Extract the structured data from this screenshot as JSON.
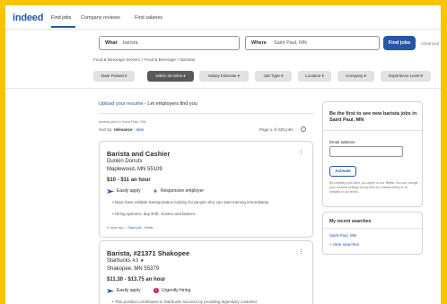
{
  "brand": {
    "logo": "indeed",
    "accent": "#2557a7"
  },
  "nav": {
    "find_jobs": "Find jobs",
    "company_reviews": "Company reviews",
    "find_salaries": "Find salaries"
  },
  "search": {
    "what_label": "What",
    "what_value": "barista",
    "where_label": "Where",
    "where_value": "Saint Paul, MN",
    "find_button": "Find jobs",
    "advanced": "Advanced"
  },
  "breadcrumb": "Food & Beverage Servers > Food & Beverage > Baristas",
  "filters": [
    {
      "label": "Date Posted",
      "active": false
    },
    {
      "label": "within 25 miles",
      "active": true
    },
    {
      "label": "Salary Estimate",
      "active": false
    },
    {
      "label": "Job Type",
      "active": false
    },
    {
      "label": "Location",
      "active": false
    },
    {
      "label": "Company",
      "active": false
    },
    {
      "label": "Experience Level",
      "active": false
    }
  ],
  "results": {
    "upload_link": "Upload your resume",
    "upload_rest": " - Let employers find you",
    "meta": "barista jobs in Saint Paul, MN",
    "sort_prefix": "Sort by: ",
    "sort_active": "relevance",
    "sort_sep": " - ",
    "sort_other": "date",
    "page_of": "Page 1 of 230 jobs"
  },
  "jobs": [
    {
      "title": "Barista and Cashier",
      "company": "Dunkin Donuts",
      "location": "Maplewood, MN 55109",
      "salary": "$10 - $11 an hour",
      "badge1": "Easily apply",
      "badge2": "Responsive employer",
      "bullet1": "Must have reliable transportation looking for people who can start training immediately.",
      "bullet2": "Hiring openers, day shift, closers and Bakers.",
      "posted": "9 days ago",
      "save": "Save job",
      "more": "More..."
    },
    {
      "title": "Barista, #21371 Shakopee",
      "company": "Starbucks",
      "rating": "4.0",
      "location": "Shakopee, MN 55379",
      "salary": "$11.30 - $13.75 an hour",
      "badge1": "Easily apply",
      "badge2": "Urgently hiring",
      "bullet1": "This position contributes to Starbucks success by providing legendary customer"
    }
  ],
  "alert": {
    "heading": "Be the first to see new barista jobs in Saint Paul, MN",
    "email_label": "Email address",
    "activate": "Activate",
    "legal_prefix": "By creating a job alert, you agree to our ",
    "legal_link": "Terms",
    "legal_rest": ". You can change your consent settings at any time by unsubscribing or as detailed in our terms."
  },
  "recent": {
    "heading": "My recent searches",
    "item1": "Saint Paul, MN",
    "clear": "» clear searches"
  }
}
